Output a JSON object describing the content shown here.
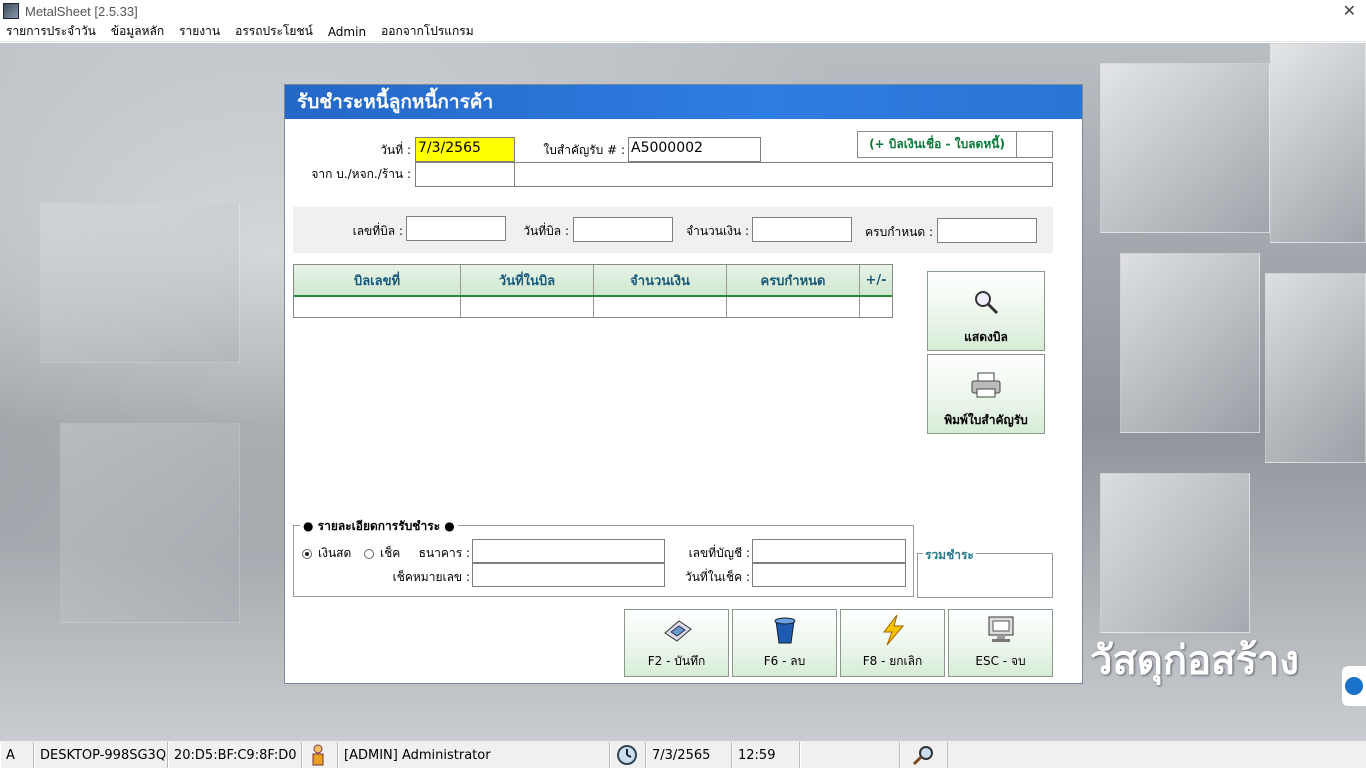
{
  "window": {
    "title": "MetalSheet [2.5.33]"
  },
  "menu": [
    "รายการประจำวัน",
    "ข้อมูลหลัก",
    "รายงาน",
    "อรรถประโยชน์",
    "Admin",
    "ออกจากโปรแกรม"
  ],
  "background": {
    "brand_text": "วัสดุก่อสร้าง"
  },
  "dialog": {
    "title": "รับชำระหนี้ลูกหนี้การค้า",
    "date_label": "วันที่ :",
    "date_value": "7/3/2565",
    "receipt_label": "ใบสำคัญรับ # :",
    "receipt_value": "A5000002",
    "from_label": "จาก บ./หจก./ร้าน :",
    "from_code": "",
    "from_name": "",
    "link_button": "(+ บิลเงินเชื่อ - ใบลดหนี้)",
    "filter": {
      "bill_no_label": "เลขที่บิล :",
      "bill_date_label": "วันที่บิล :",
      "amount_label": "จำนวนเงิน :",
      "due_label": "ครบกำหนด :"
    },
    "grid": {
      "columns": [
        "บิลเลขที่",
        "วันที่ในบิล",
        "จำนวนเงิน",
        "ครบกำหนด",
        "+/-"
      ],
      "rows": []
    },
    "show_bill_button": "แสดงบิล",
    "print_button": "พิมพ์ใบสำคัญรับ",
    "payment": {
      "legend": "● รายละเอียดการรับชำระ ●",
      "cash_label": "เงินสด",
      "cheque_label": "เช็ค",
      "selected": "cash",
      "bank_label": "ธนาคาร :",
      "cheque_no_label": "เช็คหมายเลข :",
      "account_label": "เลขที่บัญชี :",
      "cheque_date_label": "วันที่ในเช็ค :",
      "total_label": "รวมชำระ"
    },
    "actions": {
      "save": "F2 - บันทึก",
      "delete": "F6 - ลบ",
      "cancel": "F8 - ยกเลิก",
      "exit": "ESC - จบ"
    }
  },
  "statusbar": {
    "mode": "A",
    "computer": "DESKTOP-998SG3Q",
    "mac": "20:D5:BF:C9:8F:D0",
    "user": "[ADMIN] Administrator",
    "date": "7/3/2565",
    "time": "12:59"
  }
}
